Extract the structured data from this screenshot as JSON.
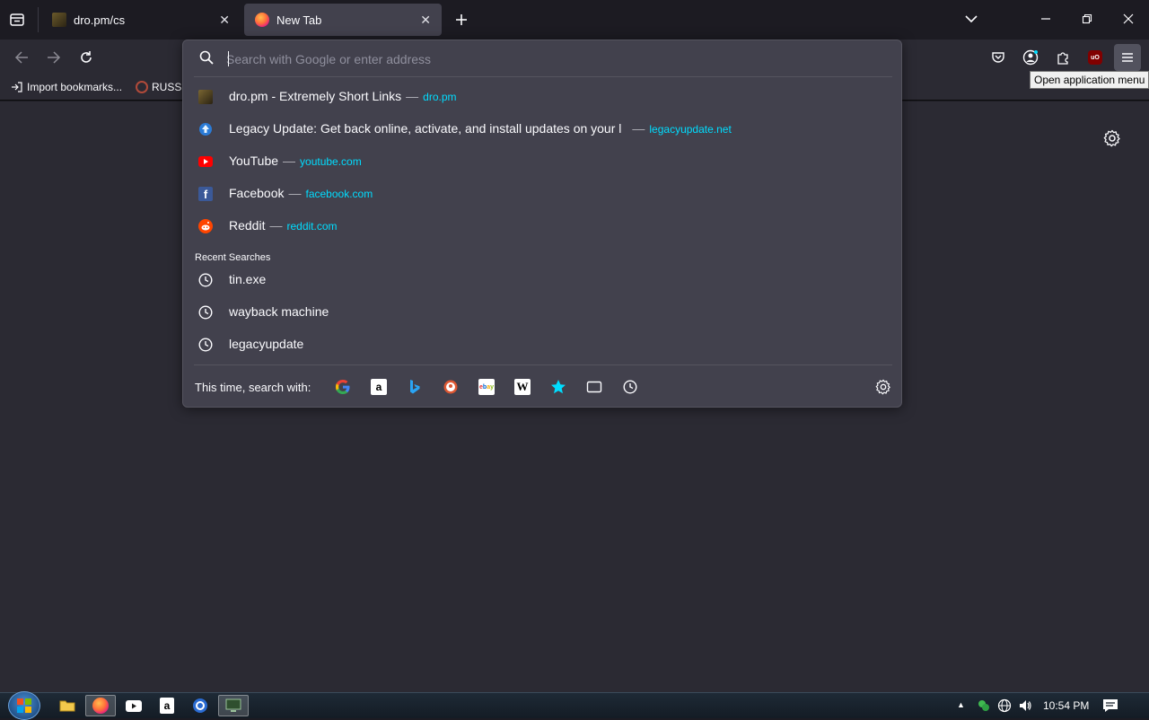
{
  "tabs": [
    {
      "title": "dro.pm/cs",
      "active": false
    },
    {
      "title": "New Tab",
      "active": true
    }
  ],
  "urlbar": {
    "placeholder": "Search with Google or enter address",
    "results": [
      {
        "icon": "dro-pm-favicon",
        "title": "dro.pm - Extremely Short Links",
        "url": "dro.pm"
      },
      {
        "icon": "legacyupdate-favicon",
        "title": "Legacy Update: Get back online, activate, and install updates on your l",
        "url": "legacyupdate.net"
      },
      {
        "icon": "youtube-favicon",
        "title": "YouTube",
        "url": "youtube.com"
      },
      {
        "icon": "facebook-favicon",
        "title": "Facebook",
        "url": "facebook.com"
      },
      {
        "icon": "reddit-favicon",
        "title": "Reddit",
        "url": "reddit.com"
      }
    ],
    "dash": "—",
    "recent_label": "Recent Searches",
    "recent": [
      "tin.exe",
      "wayback machine",
      "legacyupdate"
    ],
    "oneoff_label": "This time, search with:",
    "engines": [
      "google-icon",
      "amazon-icon",
      "bing-icon",
      "duckduckgo-icon",
      "ebay-icon",
      "wikipedia-icon",
      "bookmarks-star-icon",
      "tabs-icon",
      "history-icon"
    ]
  },
  "bookmarks": [
    {
      "label": "Import bookmarks...",
      "icon": "import-icon"
    },
    {
      "label": "RUSSI",
      "icon": "bookmark-favicon"
    }
  ],
  "tooltip": "Open application menu",
  "taskbar": {
    "clock": "10:54 PM"
  },
  "colors": {
    "url_accent": "#00ddff",
    "panel": "#42414d",
    "toolbar": "#2b2a33",
    "tabstrip": "#1c1b22"
  }
}
